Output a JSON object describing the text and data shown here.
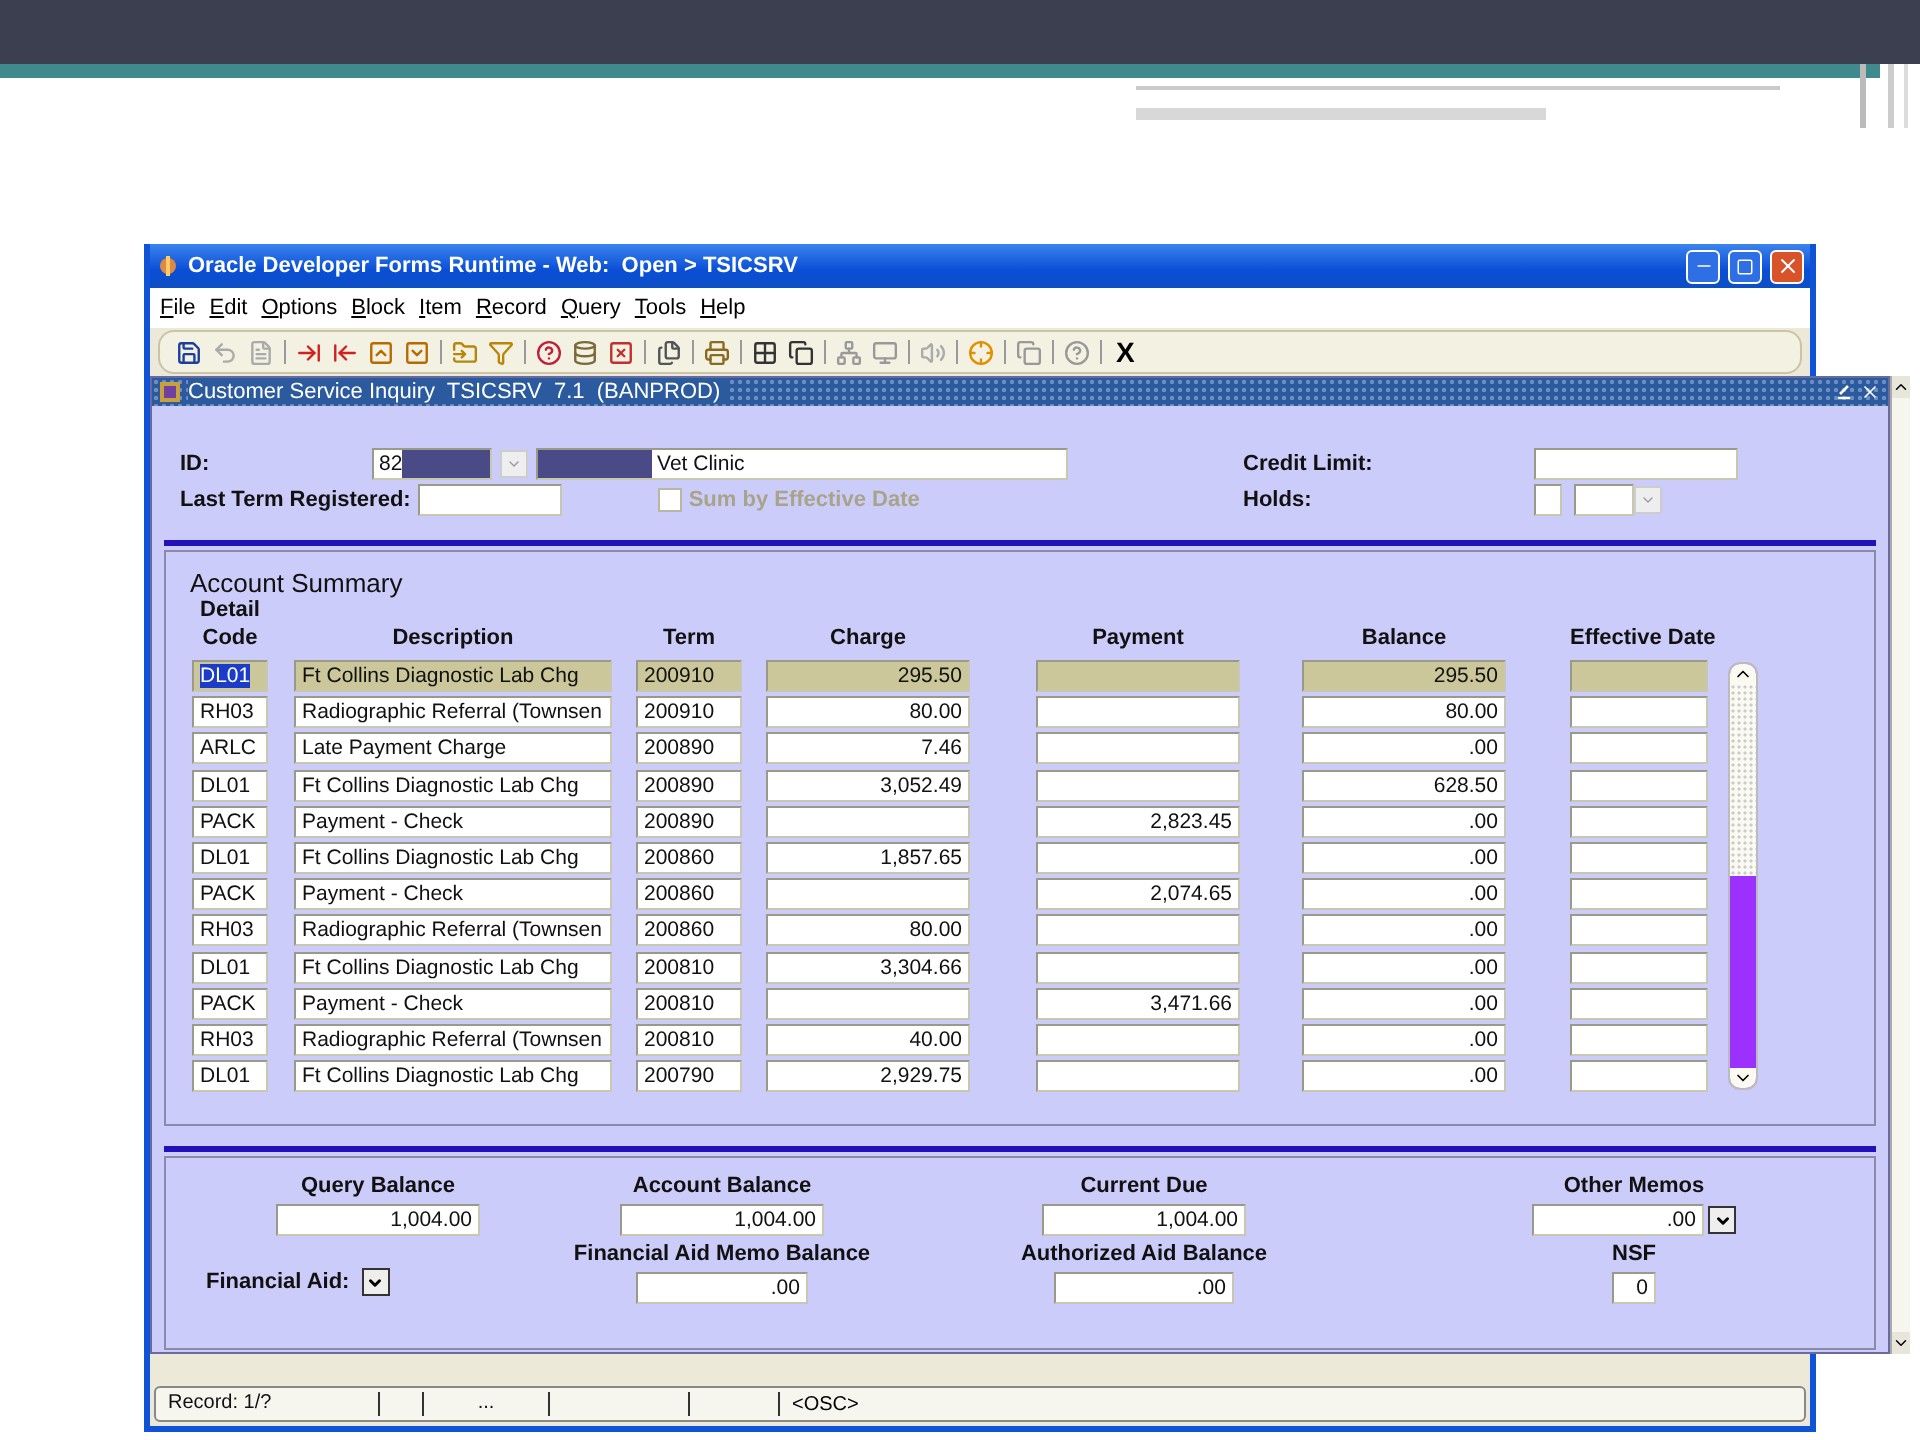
{
  "window": {
    "title": "Oracle Developer Forms Runtime - Web:  Open > TSICSRV"
  },
  "menu": [
    "File",
    "Edit",
    "Options",
    "Block",
    "Item",
    "Record",
    "Query",
    "Tools",
    "Help"
  ],
  "toolbar": {
    "exit_label": "X"
  },
  "form": {
    "title": "Customer Service Inquiry  TSICSRV  7.1  (BANPROD)"
  },
  "header": {
    "id_label": "ID:",
    "id_value": "82",
    "name_value": "Vet Clinic",
    "last_term_label": "Last Term Registered:",
    "sum_by_effective_date": {
      "label": "Sum by Effective Date",
      "checked": false,
      "disabled": true
    },
    "credit_limit_label": "Credit Limit:",
    "holds_label": "Holds:"
  },
  "account_summary": {
    "title": "Account Summary",
    "columns": [
      "Detail Code",
      "Description",
      "Term",
      "Charge",
      "Payment",
      "Balance",
      "Effective Date"
    ],
    "rows": [
      {
        "code": "DL01",
        "description": "Ft Collins Diagnostic Lab Chg",
        "term": "200910",
        "charge": "295.50",
        "payment": "",
        "balance": "295.50",
        "selected": true
      },
      {
        "code": "RH03",
        "description": "Radiographic Referral (Townsen",
        "term": "200910",
        "charge": "80.00",
        "payment": "",
        "balance": "80.00",
        "selected": false
      },
      {
        "code": "ARLC",
        "description": "Late Payment Charge",
        "term": "200890",
        "charge": "7.46",
        "payment": "",
        "balance": ".00",
        "selected": false
      },
      {
        "code": "DL01",
        "description": "Ft Collins Diagnostic Lab Chg",
        "term": "200890",
        "charge": "3,052.49",
        "payment": "",
        "balance": "628.50",
        "selected": false
      },
      {
        "code": "PACK",
        "description": "Payment - Check",
        "term": "200890",
        "charge": "",
        "payment": "2,823.45",
        "balance": ".00",
        "selected": false
      },
      {
        "code": "DL01",
        "description": "Ft Collins Diagnostic Lab Chg",
        "term": "200860",
        "charge": "1,857.65",
        "payment": "",
        "balance": ".00",
        "selected": false
      },
      {
        "code": "PACK",
        "description": "Payment - Check",
        "term": "200860",
        "charge": "",
        "payment": "2,074.65",
        "balance": ".00",
        "selected": false
      },
      {
        "code": "RH03",
        "description": "Radiographic Referral (Townsen",
        "term": "200860",
        "charge": "80.00",
        "payment": "",
        "balance": ".00",
        "selected": false
      },
      {
        "code": "DL01",
        "description": "Ft Collins Diagnostic Lab Chg",
        "term": "200810",
        "charge": "3,304.66",
        "payment": "",
        "balance": ".00",
        "selected": false
      },
      {
        "code": "PACK",
        "description": "Payment - Check",
        "term": "200810",
        "charge": "",
        "payment": "3,471.66",
        "balance": ".00",
        "selected": false
      },
      {
        "code": "RH03",
        "description": "Radiographic Referral (Townsen",
        "term": "200810",
        "charge": "40.00",
        "payment": "",
        "balance": ".00",
        "selected": false
      },
      {
        "code": "DL01",
        "description": "Ft Collins Diagnostic Lab Chg",
        "term": "200790",
        "charge": "2,929.75",
        "payment": "",
        "balance": ".00",
        "selected": false
      }
    ]
  },
  "totals": {
    "query_balance": {
      "label": "Query Balance",
      "value": "1,004.00"
    },
    "account_balance": {
      "label": "Account Balance",
      "value": "1,004.00"
    },
    "current_due": {
      "label": "Current Due",
      "value": "1,004.00"
    },
    "other_memos": {
      "label": "Other Memos",
      "value": ".00"
    },
    "financial_aid_label": "Financial Aid:",
    "financial_aid_memo_balance": {
      "label": "Financial Aid Memo Balance",
      "value": ".00"
    },
    "authorized_aid_balance": {
      "label": "Authorized Aid Balance",
      "value": ".00"
    },
    "nsf": {
      "label": "NSF",
      "value": "0"
    }
  },
  "status_bar": {
    "record": "Record: 1/?",
    "field_4": "...",
    "mode": "<OSC>"
  }
}
